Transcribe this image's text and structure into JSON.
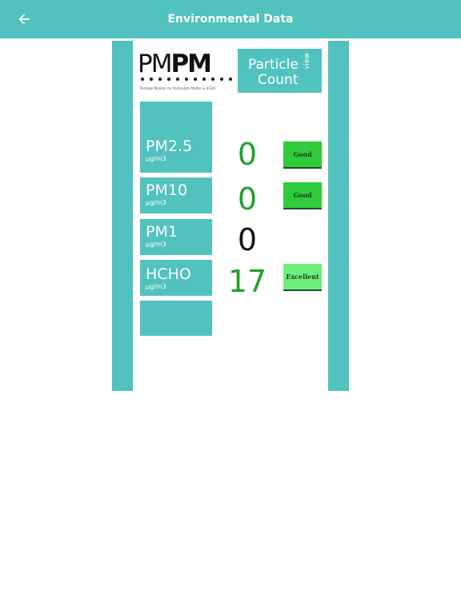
{
  "header": {
    "title": "Environmental Data",
    "back_icon": "arrow-left-icon"
  },
  "logo": {
    "word_left": "PM",
    "word_right": "PM",
    "tagline": "Portable Monitor for Particulate Matter & HCHO"
  },
  "view_button": {
    "line1": "Particle",
    "line2": "Count",
    "side_label": "view"
  },
  "metrics": [
    {
      "name": "PM2.5",
      "unit": "μg/m3",
      "value": "0",
      "value_color": "#1fa12a",
      "status": "Good",
      "status_color": "#2fcb3a"
    },
    {
      "name": "PM10",
      "unit": "μg/m3",
      "value": "0",
      "value_color": "#1fa12a",
      "status": "Good",
      "status_color": "#2fcb3a"
    },
    {
      "name": "PM1",
      "unit": "μg/m3",
      "value": "0",
      "value_color": "#111111",
      "status": "",
      "status_color": ""
    },
    {
      "name": "HCHO",
      "unit": "μg/m3",
      "value": "17",
      "value_color": "#1fa12a",
      "status": "Excellent",
      "status_color": "#6ff07b"
    }
  ],
  "colors": {
    "accent": "#51c2bd"
  }
}
